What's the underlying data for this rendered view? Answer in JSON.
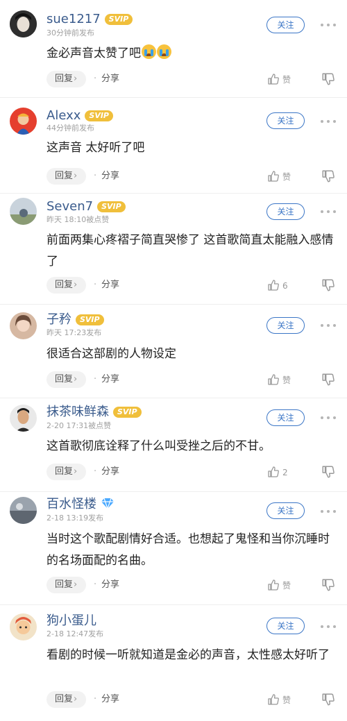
{
  "comments": [
    {
      "username": "sue1217",
      "badge": "SVIP",
      "meta": "30分钟前发布",
      "follow": "关注",
      "content": "金必声音太赞了吧",
      "reply": "回复",
      "share": "分享",
      "like": "赞"
    },
    {
      "username": "Alexx",
      "badge": "SVIP",
      "meta": "44分钟前发布",
      "follow": "关注",
      "content": "这声音 太好听了吧",
      "reply": "回复",
      "share": "分享",
      "like": "赞"
    },
    {
      "username": "Seven7",
      "badge": "SVIP",
      "meta": "昨天 18:10被点赞",
      "follow": "关注",
      "content": "前面两集心疼褶子简直哭惨了  这首歌简直太能融入感情了",
      "reply": "回复",
      "share": "分享",
      "like": "6"
    },
    {
      "username": "子矜",
      "badge": "SVIP",
      "meta": "昨天 17:23发布",
      "follow": "关注",
      "content": "很适合这部剧的人物设定",
      "reply": "回复",
      "share": "分享",
      "like": "赞"
    },
    {
      "username": "抹茶味鲜森",
      "badge": "SVIP",
      "meta": "2-20 17:31被点赞",
      "follow": "关注",
      "content": "这首歌彻底诠释了什么叫受挫之后的不甘。",
      "reply": "回复",
      "share": "分享",
      "like": "2"
    },
    {
      "username": "百水怪楼",
      "badge": "",
      "meta": "2-18 13:19发布",
      "follow": "关注",
      "content": "当时这个歌配剧情好合适。也想起了鬼怪和当你沉睡时的名场面配的名曲。",
      "reply": "回复",
      "share": "分享",
      "like": "赞"
    },
    {
      "username": "狗小蛋儿",
      "badge": "",
      "meta": "2-18 12:47发布",
      "follow": "关注",
      "content": "看剧的时候一听就知道是金必的声音，太性感太好听了",
      "reply": "回复",
      "share": "分享",
      "like": "赞"
    }
  ],
  "colors": {
    "username": "#3a5b8c",
    "badge": "#f0bf3b",
    "follow": "#3a75c6",
    "meta": "#a0a0a0",
    "content": "#222222"
  },
  "icons": [
    "avatar",
    "svip-badge",
    "diamond-icon",
    "more-icon",
    "chevron-right-icon",
    "thumbs-up-icon",
    "thumbs-down-icon",
    "crying-emoji-icon"
  ]
}
